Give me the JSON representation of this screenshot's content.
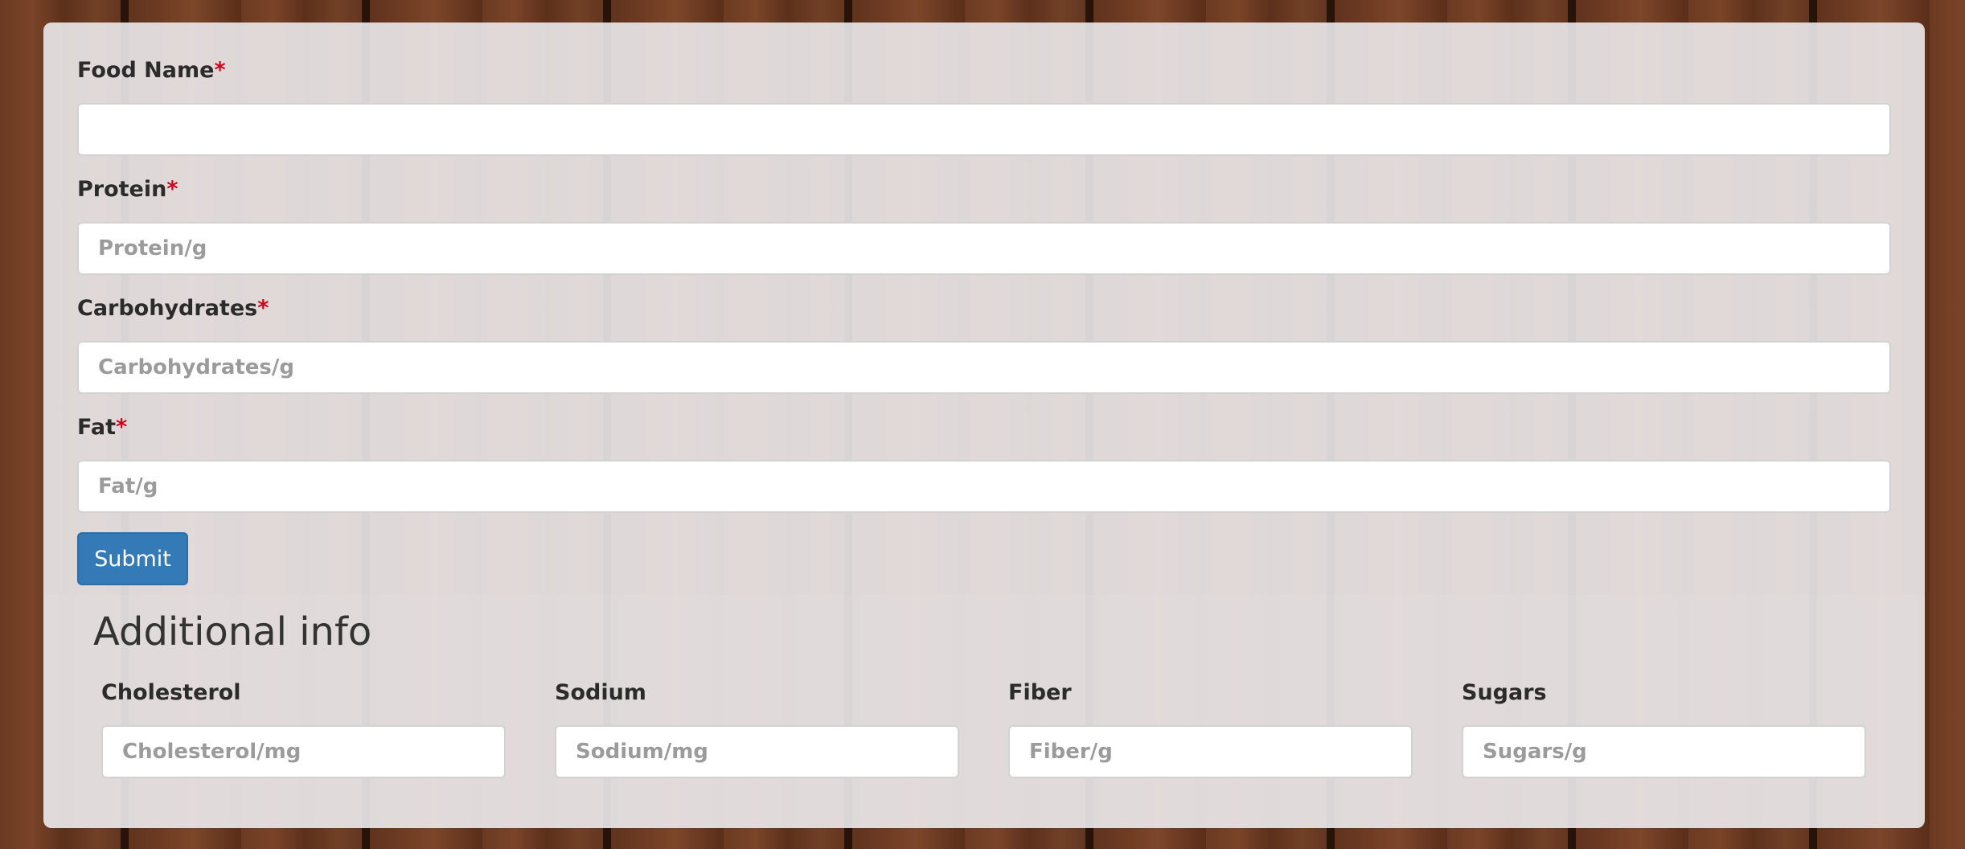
{
  "form": {
    "required_marker": "*",
    "fields": [
      {
        "label": "Food Name",
        "placeholder": "",
        "value": ""
      },
      {
        "label": "Protein",
        "placeholder": "Protein/g",
        "value": ""
      },
      {
        "label": "Carbohydrates",
        "placeholder": "Carbohydrates/g",
        "value": ""
      },
      {
        "label": "Fat",
        "placeholder": "Fat/g",
        "value": ""
      }
    ],
    "submit_label": "Submit"
  },
  "additional": {
    "title": "Additional info",
    "fields": [
      {
        "label": "Cholesterol",
        "placeholder": "Cholesterol/mg",
        "value": ""
      },
      {
        "label": "Sodium",
        "placeholder": "Sodium/mg",
        "value": ""
      },
      {
        "label": "Fiber",
        "placeholder": "Fiber/g",
        "value": ""
      },
      {
        "label": "Sugars",
        "placeholder": "Sugars/g",
        "value": ""
      }
    ]
  },
  "colors": {
    "submit_bg": "#337ab7",
    "required_marker": "#d0021b",
    "panel": "#eceaec"
  }
}
